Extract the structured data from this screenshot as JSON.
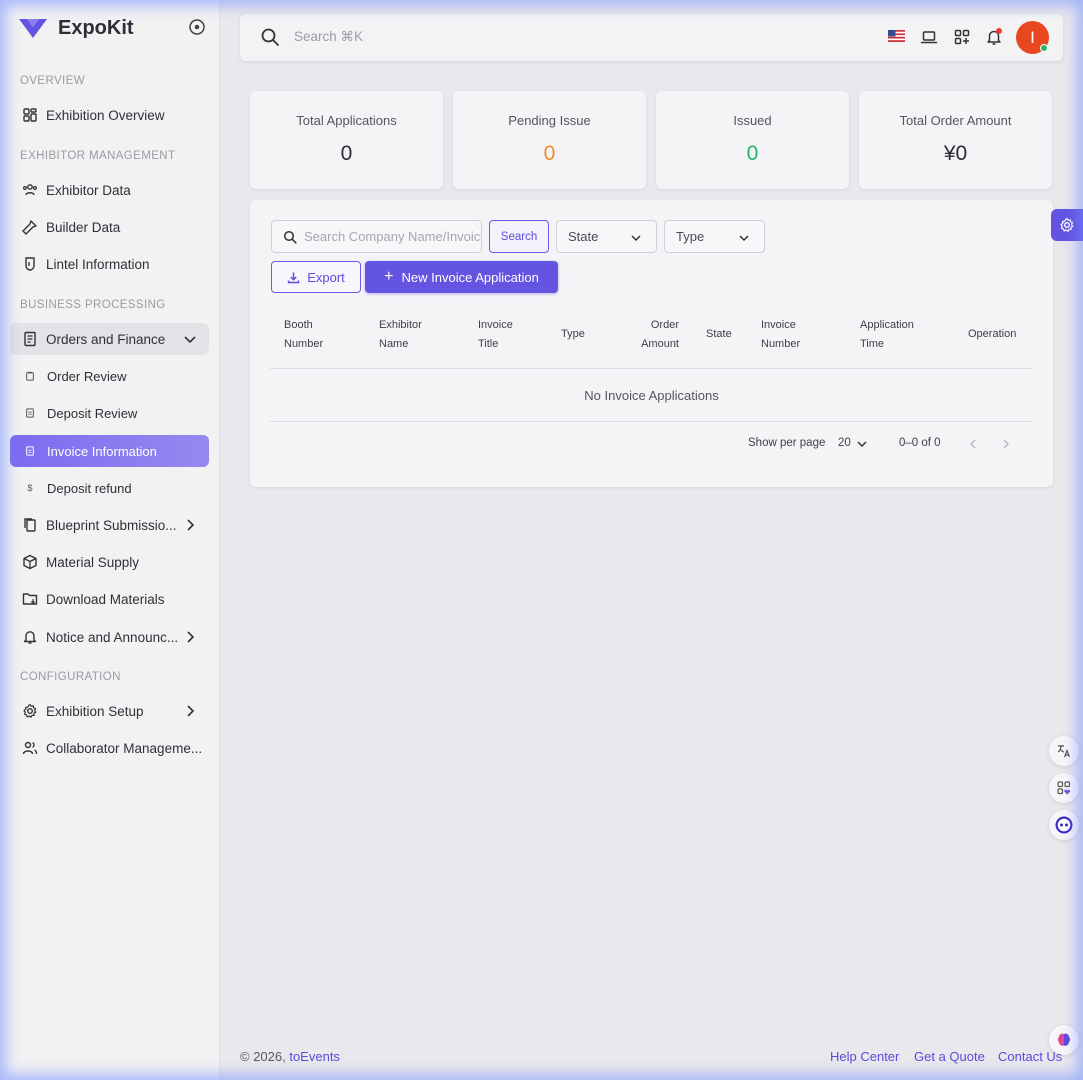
{
  "brand": {
    "name": "ExpoKit"
  },
  "sidebar": {
    "sections": {
      "overview": "OVERVIEW",
      "exhibitor_management": "EXHIBITOR MANAGEMENT",
      "business_processing": "BUSINESS PROCESSING",
      "configuration": "CONFIGURATION"
    },
    "items": {
      "exhibition_overview": "Exhibition Overview",
      "exhibitor_data": "Exhibitor Data",
      "builder_data": "Builder Data",
      "lintel_information": "Lintel Information",
      "orders_and_finance": "Orders and Finance",
      "order_review": "Order Review",
      "deposit_review": "Deposit Review",
      "invoice_information": "Invoice Information",
      "deposit_refund": "Deposit refund",
      "blueprint_submission": "Blueprint Submissio...",
      "material_supply": "Material Supply",
      "download_materials": "Download Materials",
      "notice_and_announcements": "Notice and Announc...",
      "exhibition_setup": "Exhibition Setup",
      "collaborator_management": "Collaborator Manageme..."
    },
    "deposit_refund_icon": "$"
  },
  "topbar": {
    "search_placeholder": "Search ⌘K",
    "avatar_initial": "I",
    "icons": [
      "search-icon",
      "us-flag-icon",
      "laptop-icon",
      "apps-add-icon",
      "bell-icon"
    ]
  },
  "stats": [
    {
      "label": "Total Applications",
      "value": "0"
    },
    {
      "label": "Pending Issue",
      "value": "0",
      "color": "#f08c2a"
    },
    {
      "label": "Issued",
      "value": "0",
      "color": "#22b26b"
    },
    {
      "label": "Total Order Amount",
      "value": "¥0"
    }
  ],
  "filters": {
    "search_placeholder": "Search Company Name/Invoice",
    "search_button": "Search",
    "state_label": "State",
    "type_label": "Type"
  },
  "actions": {
    "export": "Export",
    "new_application": "New Invoice Application"
  },
  "table": {
    "columns": [
      [
        "Booth",
        "Number"
      ],
      [
        "Exhibitor",
        "Name"
      ],
      [
        "Invoice",
        "Title"
      ],
      [
        "Type"
      ],
      [
        "Order",
        "Amount"
      ],
      [
        "State"
      ],
      [
        "Invoice",
        "Number"
      ],
      [
        "Application",
        "Time"
      ],
      [
        "Operation"
      ]
    ],
    "empty_text": "No Invoice Applications"
  },
  "pagination": {
    "per_page_label": "Show per page",
    "per_page_value": "20",
    "range": "0–0 of 0"
  },
  "footer": {
    "copyright": "© 2026, ",
    "company": "toEvents",
    "links": [
      "Help Center",
      "Get a Quote",
      "Contact Us"
    ]
  },
  "colors": {
    "accent": "#6354e2",
    "sidebar_active": "#7b6cf0",
    "pending": "#f08c2a",
    "issued": "#22b26b",
    "avatar": "#e8481f"
  }
}
